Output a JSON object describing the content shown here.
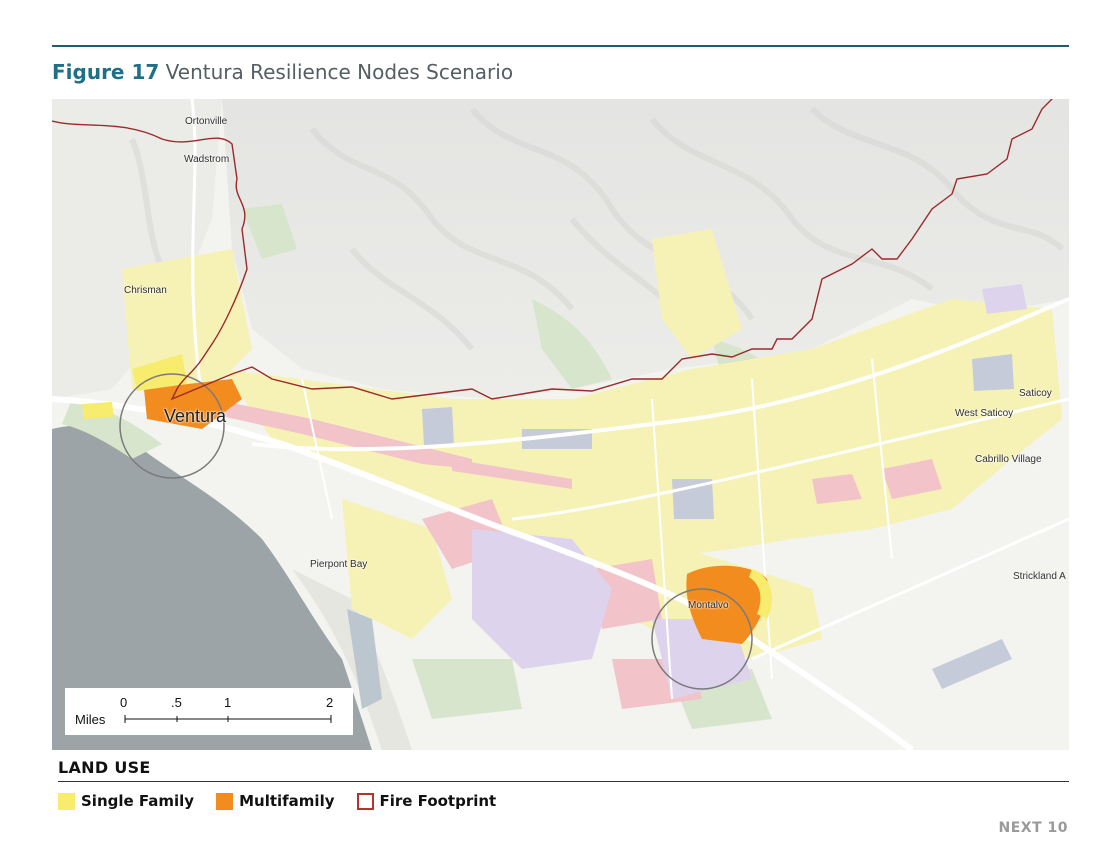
{
  "header": {
    "figure_number": "Figure 17",
    "figure_title": "Ventura Resilience Nodes Scenario"
  },
  "map": {
    "place_labels": {
      "ortonville": "Ortonville",
      "wadstrom": "Wadstrom",
      "chrisman": "Chrisman",
      "ventura": "Ventura",
      "saticoy": "Saticoy",
      "west_saticoy": "West Saticoy",
      "cabrillo_village": "Cabrillo Village",
      "pierpont_bay": "Pierpont Bay",
      "montalvo": "Montalvo",
      "strickland": "Strickland A"
    },
    "scale_bar": {
      "unit_label": "Miles",
      "ticks": [
        "0",
        ".5",
        "1",
        "2"
      ]
    }
  },
  "legend": {
    "title": "LAND USE",
    "items": [
      {
        "label": "Single Family",
        "color": "#f7ec6e",
        "type": "fill"
      },
      {
        "label": "Multifamily",
        "color": "#f28c1e",
        "type": "fill"
      },
      {
        "label": "Fire Footprint",
        "color": "#b5332e",
        "type": "outline"
      }
    ]
  },
  "colors": {
    "title_accent": "#1f6f86",
    "fire_boundary": "#9b2b2b",
    "ocean": "#9aa3a6",
    "single_family_area": "#f5f0b4",
    "commercial_area": "#f3c3c8",
    "institutional_area": "#dcd0ea",
    "industrial_area": "#c6ccd8",
    "open_space": "#cfe0c4"
  },
  "footer": {
    "page_label": "NEXT 10"
  }
}
